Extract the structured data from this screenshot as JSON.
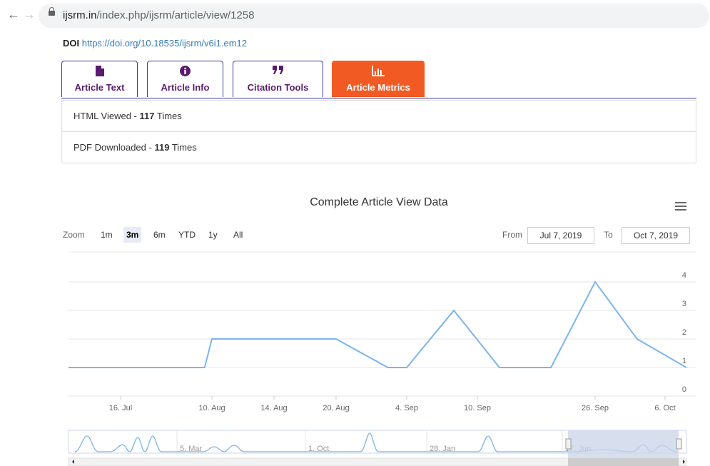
{
  "browser": {
    "url_domain": "ijsrm.in",
    "url_path": "/index.php/ijsrm/article/view/1258"
  },
  "doi": {
    "label": "DOI",
    "link": "https://doi.org/10.18535/ijsrm/v6i1.em12"
  },
  "tabs": [
    {
      "label": "Article Text",
      "icon": "file-icon",
      "glyph": "▮"
    },
    {
      "label": "Article Info",
      "icon": "info-icon",
      "glyph": "❶"
    },
    {
      "label": "Citation Tools",
      "icon": "quote-icon",
      "glyph": "❞"
    },
    {
      "label": "Article Metrics",
      "icon": "bar-chart-icon",
      "glyph": "▁▃▅",
      "active": true
    }
  ],
  "metrics": {
    "html_prefix": "HTML Viewed - ",
    "html_count": "117",
    "html_suffix": " Times",
    "pdf_prefix": "PDF Downloaded - ",
    "pdf_count": "119",
    "pdf_suffix": " Times"
  },
  "chart_controls": {
    "zoom_label": "Zoom",
    "zoom_buttons": [
      "1m",
      "3m",
      "6m",
      "YTD",
      "1y",
      "All"
    ],
    "zoom_selected": "3m",
    "from_label": "From",
    "from_value": "Jul 7, 2019",
    "to_label": "To",
    "to_value": "Oct 7, 2019"
  },
  "colors": {
    "accent": "#f15a22",
    "tab_border": "#3b3ba8",
    "line": "#7cb5ec",
    "navigator_mask": "#c9d4ea"
  },
  "chart_data": {
    "type": "line",
    "title": "Complete Article View Data",
    "xlabel": "",
    "ylabel": "",
    "x_ticks": [
      "16. Jul",
      "10. Aug",
      "14. Aug",
      "20. Aug",
      "4. Sep",
      "10. Sep",
      "26. Sep",
      "6. Oct"
    ],
    "y_ticks": [
      0,
      1,
      2,
      3,
      4
    ],
    "ylim": [
      0,
      4
    ],
    "series": [
      {
        "points": [
          {
            "x": "7. Jul",
            "y": 1
          },
          {
            "x": "8. Aug",
            "y": 1
          },
          {
            "x": "10. Aug",
            "y": 2
          },
          {
            "x": "14. Aug",
            "y": 2
          },
          {
            "x": "20. Aug",
            "y": 2
          },
          {
            "x": "31. Aug",
            "y": 1
          },
          {
            "x": "4. Sep",
            "y": 1
          },
          {
            "x": "8. Sep",
            "y": 3
          },
          {
            "x": "13. Sep",
            "y": 1
          },
          {
            "x": "20. Sep",
            "y": 1
          },
          {
            "x": "26. Sep",
            "y": 4
          },
          {
            "x": "2. Oct",
            "y": 2
          },
          {
            "x": "7. Oct",
            "y": 1
          }
        ]
      }
    ],
    "grid": true,
    "navigator": {
      "labels": [
        "5. Mar",
        "1. Oct",
        "28. Jan",
        "17. Jun"
      ]
    }
  }
}
